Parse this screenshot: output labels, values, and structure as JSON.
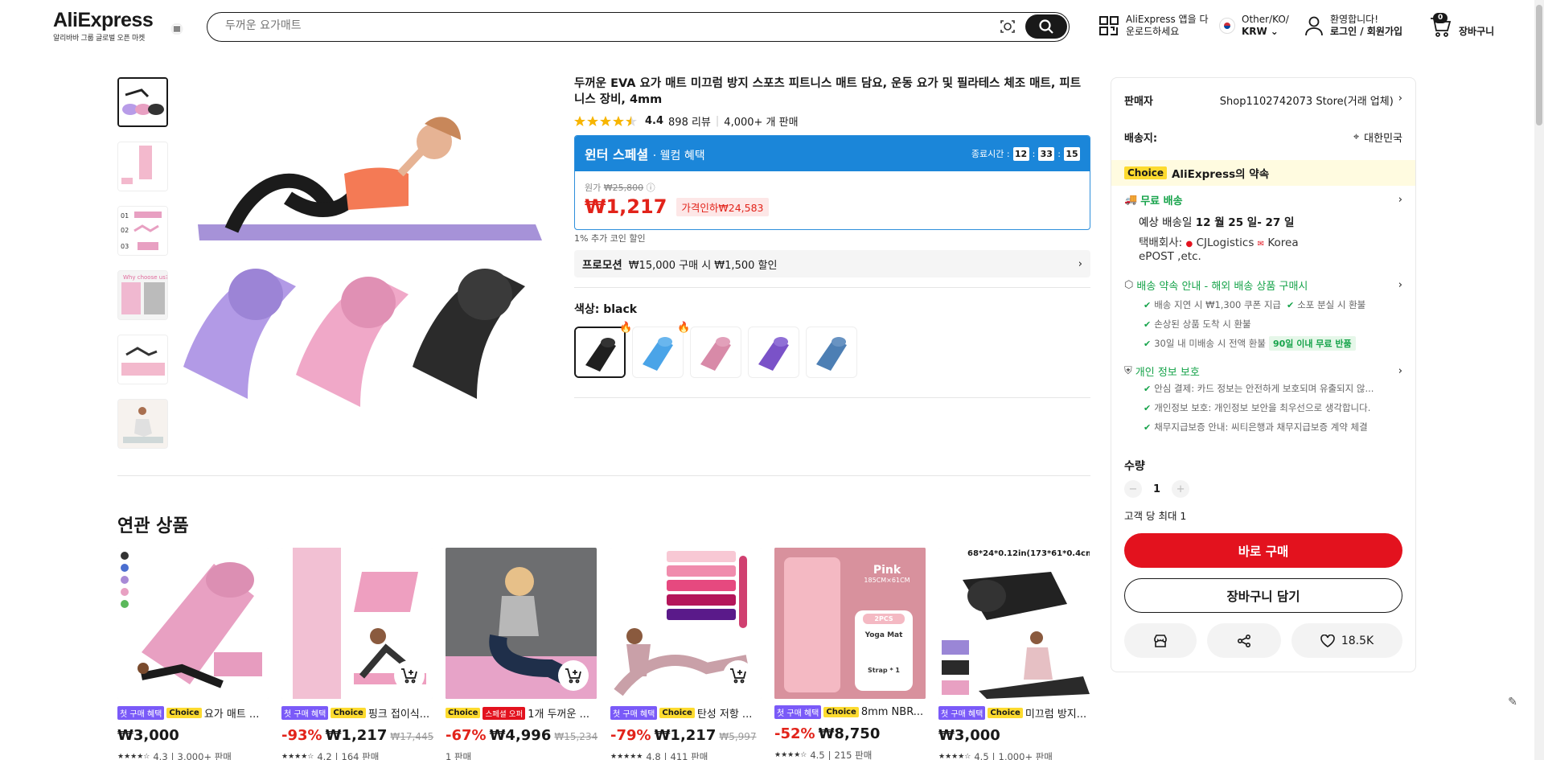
{
  "header": {
    "logo": "AliExpress",
    "logo_sub": "알리바바 그룹 글로벌 오픈 마켓",
    "search_placeholder": "두꺼운 요가매트",
    "app_line1": "AliExpress 앱을 다",
    "app_line2": "운로드하세요",
    "locale_line1": "Other/KO/",
    "locale_line2": "KRW",
    "account_line1": "환영합니다!",
    "account_line2": "로그인 / 회원가입",
    "cart_count": "0",
    "cart_label": "장바구니"
  },
  "product": {
    "title": "두꺼운 EVA 요가 매트 미끄럼 방지 스포츠 피트니스 매트 담요, 운동 요가 및 필라테스 체조 매트, 피트니스 장비, 4mm",
    "rating": "4.4",
    "reviews": "898 리뷰",
    "sold": "4,000+ 개 판매",
    "deal_title": "윈터 스페셜",
    "deal_subtitle": "· 웰컴 혜택",
    "timer_label": "종료시간 :",
    "timer_h": "12",
    "timer_m": "33",
    "timer_s": "15",
    "orig_label": "원가",
    "orig_price": "₩25,800",
    "price": "₩1,217",
    "price_drop": "가격인하₩24,583",
    "coin_note": "1% 추가 코인 할인",
    "promo_label": "프로모션",
    "promo_text": "₩15,000 구매 시 ₩1,500 할인",
    "color_label": "색상: black",
    "colors": [
      "black",
      "sky blue",
      "pink",
      "purple",
      "blue"
    ]
  },
  "panel": {
    "seller_label": "판매자",
    "seller_name": "Shop1102742073 Store(거래 업체)",
    "ship_label": "배송지:",
    "ship_to": "대한민국",
    "choice_tag": "Choice",
    "choice_text": "AliExpress의 약속",
    "free_ship": "무료 배송",
    "eta_prefix": "예상 배송일",
    "eta": "12 월 25 일- 27 일",
    "carrier_label": "택배회사:",
    "carrier1": "CJLogistics",
    "carrier2": "Korea",
    "carrier3": "ePOST ,etc.",
    "promise_title": "배송 약속 안내 - 해외 배송 상품 구매시",
    "promise1": "배송 지연 시 ₩1,300 쿠폰 지급",
    "promise2": "소포 분실 시 환불",
    "promise3": "손상된 상품 도착 시 환불",
    "promise4": "30일 내 미배송 시 전액 환불",
    "promise_badge": "90일 이내 무료 반품",
    "privacy_title": "개인 정보 보호",
    "privacy1": "안심 결제: 카드 정보는 안전하게 보호되며 유출되지 않...",
    "privacy2": "개인정보 보호: 개인정보 보안을 최우선으로 생각합니다.",
    "privacy3": "채무지급보증 안내: 씨티은행과 채무지급보증 계약 체결",
    "qty_label": "수량",
    "qty": "1",
    "qty_limit": "고객 당 최대 1",
    "buy_now": "바로 구매",
    "add_cart": "장바구니 담기",
    "wish_count": "18.5K"
  },
  "related": {
    "title": "연관 상품",
    "tag_first": "첫 구매 혜택",
    "tag_choice": "Choice",
    "tag_super": "스페셜 오퍼",
    "items": [
      {
        "name": "요가 매트 ...",
        "discount": "",
        "price": "₩3,000",
        "orig": "",
        "rating": "4.3",
        "sold": "3,000+ 판매"
      },
      {
        "name": "핑크 접이식...",
        "discount": "-93%",
        "price": "₩1,217",
        "orig": "₩17,445",
        "rating": "4.2",
        "sold": "164 판매"
      },
      {
        "name": "1개 두꺼운 ...",
        "discount": "-67%",
        "price": "₩4,996",
        "orig": "₩15,234",
        "rating": "",
        "sold": "1 판매"
      },
      {
        "name": "탄성 저항 ...",
        "discount": "-79%",
        "price": "₩1,217",
        "orig": "₩5,997",
        "rating": "4.8",
        "sold": "411 판매"
      },
      {
        "name": "8mm NBR...",
        "discount": "-52%",
        "price": "₩8,750",
        "orig": "",
        "rating": "4.5",
        "sold": "215 판매"
      },
      {
        "name": "미끄럼 방지...",
        "discount": "",
        "price": "₩3,000",
        "orig": "",
        "rating": "4.5",
        "sold": "1,000+ 판매"
      }
    ],
    "card5_overlay_title": "Pink",
    "card5_overlay_size": "185CM×61CM",
    "card5_overlay_pcs": "2PCS",
    "card5_overlay_item1": "Yoga Mat",
    "card5_overlay_item2": "Strap * 1",
    "card6_overlay": "68*24*0.12in(173*61*0.4cm)"
  },
  "colors": {
    "accent": "#e3121e",
    "deal": "#1b86d9",
    "choice": "#fddb2f",
    "green": "#16a34a"
  }
}
